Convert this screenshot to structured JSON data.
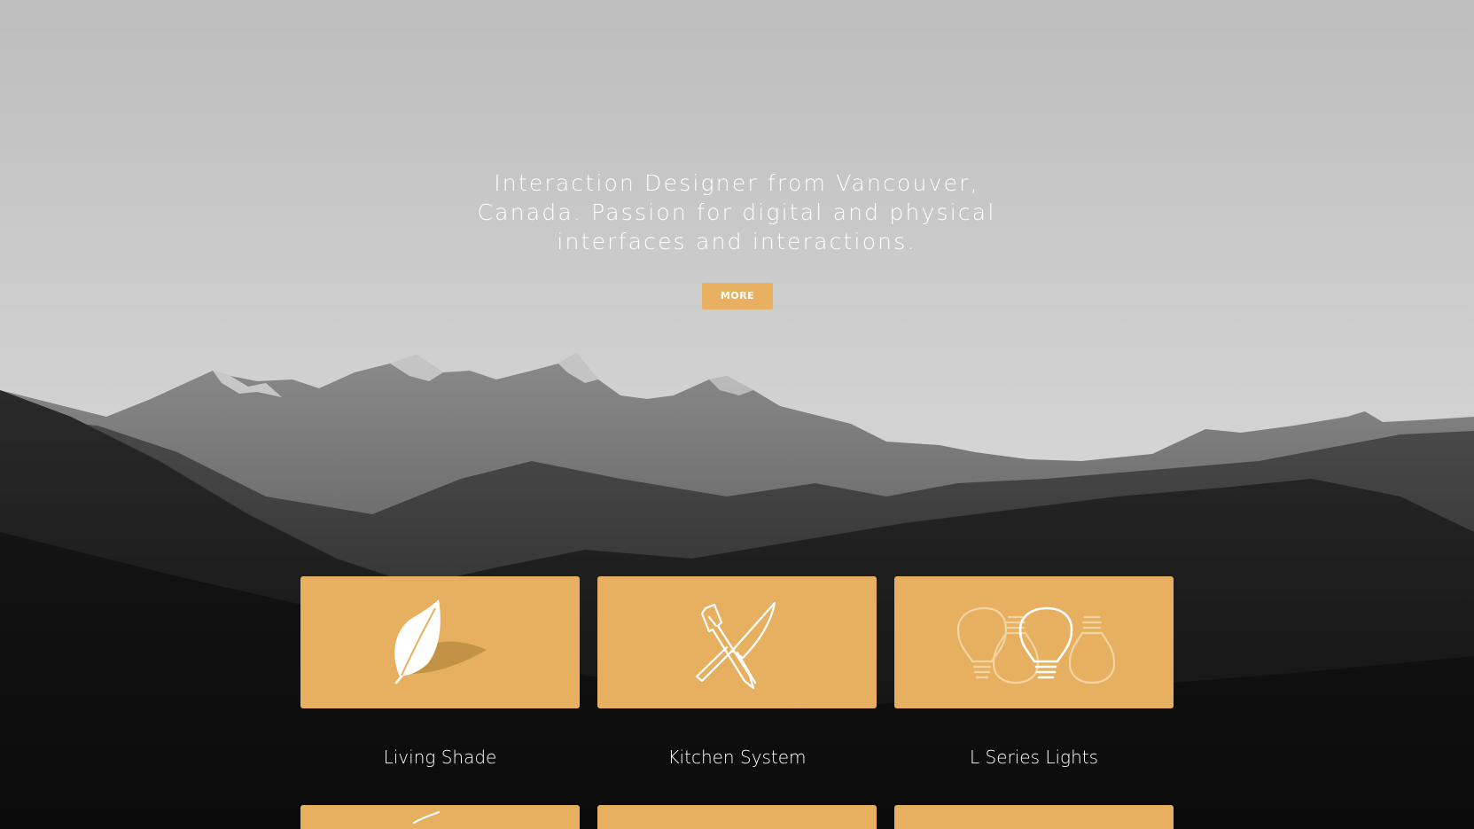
{
  "hero": {
    "tagline": "Interaction Designer from Vancouver, Canada. Passion for digital and physical interfaces and interactions.",
    "more_label": "MORE"
  },
  "projects": [
    {
      "label": "Living Shade",
      "icon": "leaf-icon"
    },
    {
      "label": "Kitchen System",
      "icon": "kitchen-utensils-icon"
    },
    {
      "label": "L Series Lights",
      "icon": "light-bulbs-icon"
    }
  ],
  "colors": {
    "accent": "#e6b060",
    "text": "#ffffff"
  }
}
